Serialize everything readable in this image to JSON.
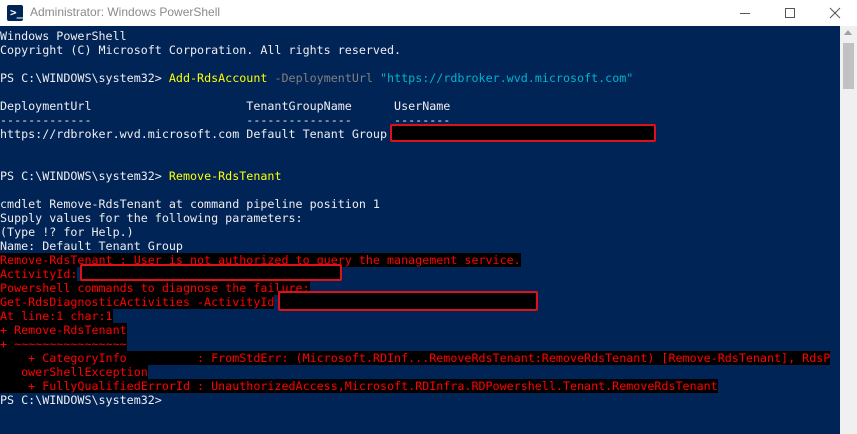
{
  "window": {
    "title": "Administrator: Windows PowerShell",
    "icon_glyph": ">_",
    "controls": {
      "minimize": "minimize-icon",
      "maximize": "maximize-icon",
      "close": "close-icon"
    }
  },
  "colors": {
    "console_bg": "#012456",
    "text": "#eeedf0",
    "cmdlet": "#ffff00",
    "parameter": "#808080",
    "string": "#00b3ce",
    "error": "#ff0000",
    "redaction_border": "#e0101b"
  },
  "console": {
    "banner_1": "Windows PowerShell",
    "banner_2": "Copyright (C) Microsoft Corporation. All rights reserved.",
    "prompt": "PS C:\\WINDOWS\\system32>",
    "cmd1": {
      "cmdlet": "Add-RdsAccount",
      "param": "-DeploymentUrl",
      "value": "\"https://rdbroker.wvd.microsoft.com\""
    },
    "table": {
      "header": "DeploymentUrl                      TenantGroupName      UserName",
      "dashes": "-------------                      ---------------      --------",
      "row": "https://rdbroker.wvd.microsoft.com Default Tenant Group"
    },
    "cmd2": {
      "cmdlet": "Remove-RdsTenant"
    },
    "prompt_lines": [
      "cmdlet Remove-RdsTenant at command pipeline position 1",
      "Supply values for the following parameters:",
      "(Type !? for Help.)",
      "Name: Default Tenant Group"
    ],
    "error_lines": [
      "Remove-RdsTenant : User is not authorized to query the management service.",
      "ActivityId:",
      "Powershell commands to diagnose the failure:",
      "Get-RdsDiagnosticActivities -ActivityId",
      "At line:1 char:1",
      "+ Remove-RdsTenant",
      "+ ~~~~~~~~~~~~~~~~",
      "    + CategoryInfo          : FromStdErr: (Microsoft.RDInf...RemoveRdsTenant:RemoveRdsTenant) [Remove-RdsTenant], RdsP",
      "   owerShellException",
      "    + FullyQualifiedErrorId : UnauthorizedAccess,Microsoft.RDInfra.RDPowershell.Tenant.RemoveRdsTenant"
    ],
    "final_prompt": "PS C:\\WINDOWS\\system32>"
  }
}
